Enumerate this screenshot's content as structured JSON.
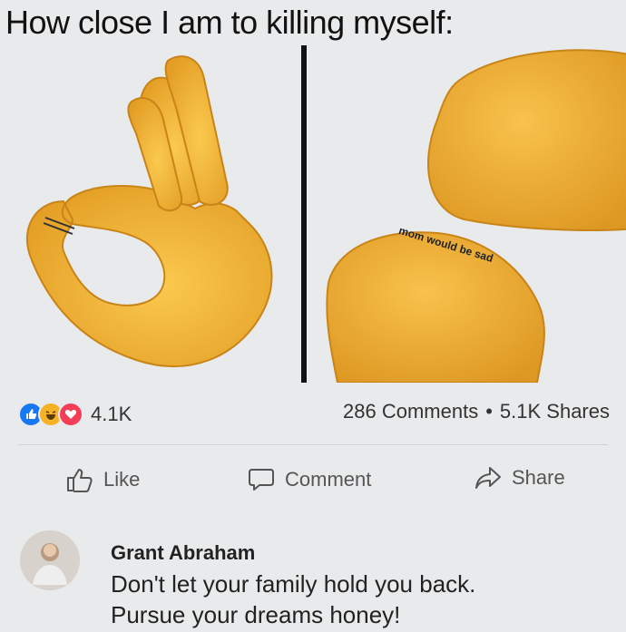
{
  "meme": {
    "title": "How close I am to killing myself:",
    "right_panel_caption": "mom would be sad"
  },
  "reactions": {
    "icons": [
      "like-icon",
      "haha-icon",
      "love-icon"
    ],
    "count": "4.1K",
    "comments": "286 Comments",
    "separator": "•",
    "shares": "5.1K Shares"
  },
  "actions": {
    "like_label": "Like",
    "comment_label": "Comment",
    "share_label": "Share"
  },
  "comment": {
    "author": "Grant Abraham",
    "line1": "Don't let your family hold you back.",
    "line2": "Pursue your dreams honey!"
  },
  "colors": {
    "skin": "#f5b83d",
    "skin_shadow": "#d8921e",
    "like_blue": "#1877f2",
    "love_red": "#f33e58",
    "haha_yellow": "#f7b125"
  }
}
